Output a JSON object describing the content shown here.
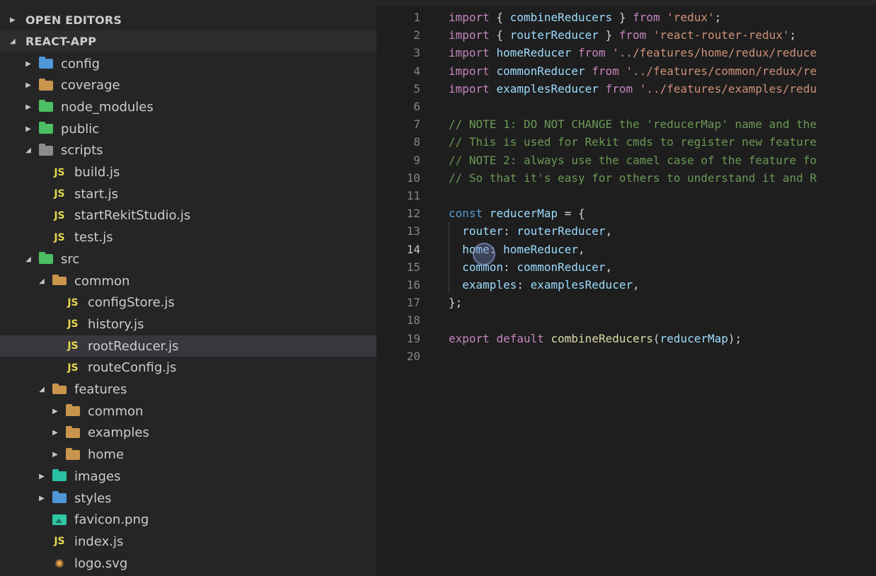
{
  "explorer": {
    "sections": [
      {
        "label": "OPEN EDITORS",
        "expanded": false
      },
      {
        "label": "REACT-APP",
        "expanded": true
      }
    ],
    "tree": [
      {
        "label": "config",
        "depth": 0,
        "kind": "folder",
        "icon": "config-folder-icon",
        "color": "#4f97d9",
        "expanded": false
      },
      {
        "label": "coverage",
        "depth": 0,
        "kind": "folder",
        "icon": "folder-icon",
        "color": "#c9954d",
        "expanded": false
      },
      {
        "label": "node_modules",
        "depth": 0,
        "kind": "folder",
        "icon": "node-folder-icon",
        "color": "#4cbf63",
        "expanded": false
      },
      {
        "label": "public",
        "depth": 0,
        "kind": "folder",
        "icon": "public-folder-icon",
        "color": "#4cbf63",
        "expanded": false
      },
      {
        "label": "scripts",
        "depth": 0,
        "kind": "folder",
        "icon": "scripts-folder-icon",
        "color": "#8c8c8c",
        "expanded": true
      },
      {
        "label": "build.js",
        "depth": 1,
        "kind": "js"
      },
      {
        "label": "start.js",
        "depth": 1,
        "kind": "js"
      },
      {
        "label": "startRekitStudio.js",
        "depth": 1,
        "kind": "js"
      },
      {
        "label": "test.js",
        "depth": 1,
        "kind": "js"
      },
      {
        "label": "src",
        "depth": 0,
        "kind": "folder",
        "icon": "src-folder-icon",
        "color": "#4cbf63",
        "expanded": true
      },
      {
        "label": "common",
        "depth": 1,
        "kind": "folder-open",
        "icon": "folder-open-icon",
        "color": "#c9954d",
        "expanded": true
      },
      {
        "label": "configStore.js",
        "depth": 2,
        "kind": "js"
      },
      {
        "label": "history.js",
        "depth": 2,
        "kind": "js"
      },
      {
        "label": "rootReducer.js",
        "depth": 2,
        "kind": "js",
        "selected": true
      },
      {
        "label": "routeConfig.js",
        "depth": 2,
        "kind": "js"
      },
      {
        "label": "features",
        "depth": 1,
        "kind": "folder-open",
        "icon": "folder-open-icon",
        "color": "#c9954d",
        "expanded": true
      },
      {
        "label": "common",
        "depth": 2,
        "kind": "folder",
        "icon": "folder-icon",
        "color": "#c9954d",
        "expanded": false
      },
      {
        "label": "examples",
        "depth": 2,
        "kind": "folder",
        "icon": "folder-icon",
        "color": "#c9954d",
        "expanded": false
      },
      {
        "label": "home",
        "depth": 2,
        "kind": "folder",
        "icon": "folder-icon",
        "color": "#c9954d",
        "expanded": false
      },
      {
        "label": "images",
        "depth": 1,
        "kind": "folder",
        "icon": "images-folder-icon",
        "color": "#28c2a3",
        "expanded": false
      },
      {
        "label": "styles",
        "depth": 1,
        "kind": "folder",
        "icon": "styles-folder-icon",
        "color": "#4f97d9",
        "expanded": false
      },
      {
        "label": "favicon.png",
        "depth": 1,
        "kind": "image",
        "icon": "image-file-icon"
      },
      {
        "label": "index.js",
        "depth": 1,
        "kind": "js"
      },
      {
        "label": "logo.svg",
        "depth": 1,
        "kind": "svg",
        "icon": "svg-file-icon"
      }
    ],
    "js_badge": "JS"
  },
  "editor": {
    "active_line": 14,
    "colors": {
      "keyword": "#c586c0",
      "identifier": "#9cdcfe",
      "function": "#dcdcaa",
      "string": "#ce9178",
      "comment": "#6a9955",
      "punct": "#d4d4d4",
      "storage": "#569cd6"
    },
    "lines": [
      [
        [
          "keyword",
          "import"
        ],
        [
          "punct",
          " { "
        ],
        [
          "identifier",
          "combineReducers"
        ],
        [
          "punct",
          " } "
        ],
        [
          "keyword",
          "from"
        ],
        [
          "punct",
          " "
        ],
        [
          "string",
          "'redux'"
        ],
        [
          "punct",
          ";"
        ]
      ],
      [
        [
          "keyword",
          "import"
        ],
        [
          "punct",
          " { "
        ],
        [
          "identifier",
          "routerReducer"
        ],
        [
          "punct",
          " } "
        ],
        [
          "keyword",
          "from"
        ],
        [
          "punct",
          " "
        ],
        [
          "string",
          "'react-router-redux'"
        ],
        [
          "punct",
          ";"
        ]
      ],
      [
        [
          "keyword",
          "import"
        ],
        [
          "punct",
          " "
        ],
        [
          "identifier",
          "homeReducer"
        ],
        [
          "punct",
          " "
        ],
        [
          "keyword",
          "from"
        ],
        [
          "punct",
          " "
        ],
        [
          "string",
          "'../features/home/redux/reduce"
        ]
      ],
      [
        [
          "keyword",
          "import"
        ],
        [
          "punct",
          " "
        ],
        [
          "identifier",
          "commonReducer"
        ],
        [
          "punct",
          " "
        ],
        [
          "keyword",
          "from"
        ],
        [
          "punct",
          " "
        ],
        [
          "string",
          "'../features/common/redux/re"
        ]
      ],
      [
        [
          "keyword",
          "import"
        ],
        [
          "punct",
          " "
        ],
        [
          "identifier",
          "examplesReducer"
        ],
        [
          "punct",
          " "
        ],
        [
          "keyword",
          "from"
        ],
        [
          "punct",
          " "
        ],
        [
          "string",
          "'../features/examples/redu"
        ]
      ],
      [],
      [
        [
          "comment",
          "// NOTE 1: DO NOT CHANGE the 'reducerMap' name and the"
        ]
      ],
      [
        [
          "comment",
          "// This is used for Rekit cmds to register new feature"
        ]
      ],
      [
        [
          "comment",
          "// NOTE 2: always use the camel case of the feature fo"
        ]
      ],
      [
        [
          "comment",
          "// So that it's easy for others to understand it and R"
        ]
      ],
      [],
      [
        [
          "storage",
          "const"
        ],
        [
          "punct",
          " "
        ],
        [
          "identifier",
          "reducerMap"
        ],
        [
          "punct",
          " = {"
        ]
      ],
      [
        [
          "punct",
          "  "
        ],
        [
          "identifier",
          "router"
        ],
        [
          "punct",
          ": "
        ],
        [
          "identifier",
          "routerReducer"
        ],
        [
          "punct",
          ","
        ]
      ],
      [
        [
          "punct",
          "  "
        ],
        [
          "identifier",
          "home"
        ],
        [
          "punct",
          ": "
        ],
        [
          "identifier",
          "homeReducer"
        ],
        [
          "punct",
          ","
        ]
      ],
      [
        [
          "punct",
          "  "
        ],
        [
          "identifier",
          "common"
        ],
        [
          "punct",
          ": "
        ],
        [
          "identifier",
          "commonReducer"
        ],
        [
          "punct",
          ","
        ]
      ],
      [
        [
          "punct",
          "  "
        ],
        [
          "identifier",
          "examples"
        ],
        [
          "punct",
          ": "
        ],
        [
          "identifier",
          "examplesReducer"
        ],
        [
          "punct",
          ","
        ]
      ],
      [
        [
          "punct",
          "};"
        ]
      ],
      [],
      [
        [
          "keyword",
          "export"
        ],
        [
          "punct",
          " "
        ],
        [
          "keyword",
          "default"
        ],
        [
          "punct",
          " "
        ],
        [
          "function",
          "combineReducers"
        ],
        [
          "punct",
          "("
        ],
        [
          "identifier",
          "reducerMap"
        ],
        [
          "punct",
          ");"
        ]
      ],
      []
    ]
  }
}
